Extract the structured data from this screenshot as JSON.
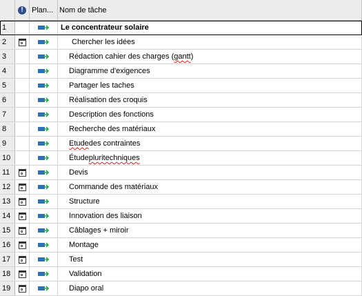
{
  "header": {
    "indicator_glyph": "!",
    "mode_label": "Plan...",
    "name_label": "Nom de tâche"
  },
  "rows": [
    {
      "num": "1",
      "name": "Le concentrateur solaire",
      "summary": true,
      "calendar": false
    },
    {
      "num": "2",
      "name": "Chercher les idées",
      "calendar": true,
      "sub": true
    },
    {
      "num": "3",
      "name_parts": [
        "Rédaction cahier des charges (",
        "gantt",
        ")"
      ],
      "calendar": false
    },
    {
      "num": "4",
      "name": "Diagramme d'exigences",
      "calendar": false
    },
    {
      "num": "5",
      "name": "Partager les taches",
      "calendar": false
    },
    {
      "num": "6",
      "name": "Réalisation des croquis",
      "calendar": false
    },
    {
      "num": "7",
      "name": "Description des fonctions",
      "calendar": false
    },
    {
      "num": "8",
      "name": "Recherche des matériaux",
      "calendar": false
    },
    {
      "num": "9",
      "name_parts": [
        "",
        "Etude",
        " des contraintes"
      ],
      "calendar": false
    },
    {
      "num": "10",
      "name_parts": [
        "Étude ",
        "pluritechniques",
        ""
      ],
      "calendar": false
    },
    {
      "num": "11",
      "name": "Devis",
      "calendar": true
    },
    {
      "num": "12",
      "name": "Commande des matériaux",
      "calendar": true
    },
    {
      "num": "13",
      "name": "Structure",
      "calendar": true
    },
    {
      "num": "14",
      "name": "Innovation des liaison",
      "calendar": true
    },
    {
      "num": "15",
      "name": "Câblages + miroir",
      "calendar": true
    },
    {
      "num": "16",
      "name": "Montage",
      "calendar": true
    },
    {
      "num": "17",
      "name": "Test",
      "calendar": true
    },
    {
      "num": "18",
      "name": "Validation",
      "calendar": true
    },
    {
      "num": "19",
      "name": "Diapo oral",
      "calendar": true
    }
  ],
  "icons": {
    "indicator": "info-icon",
    "calendar": "calendar-icon",
    "task_mode": "auto-scheduled-icon"
  },
  "colors": {
    "mode_bar": "#2f6fb5",
    "mode_arrow": "#2aa84a",
    "header_bg": "#ececec"
  }
}
